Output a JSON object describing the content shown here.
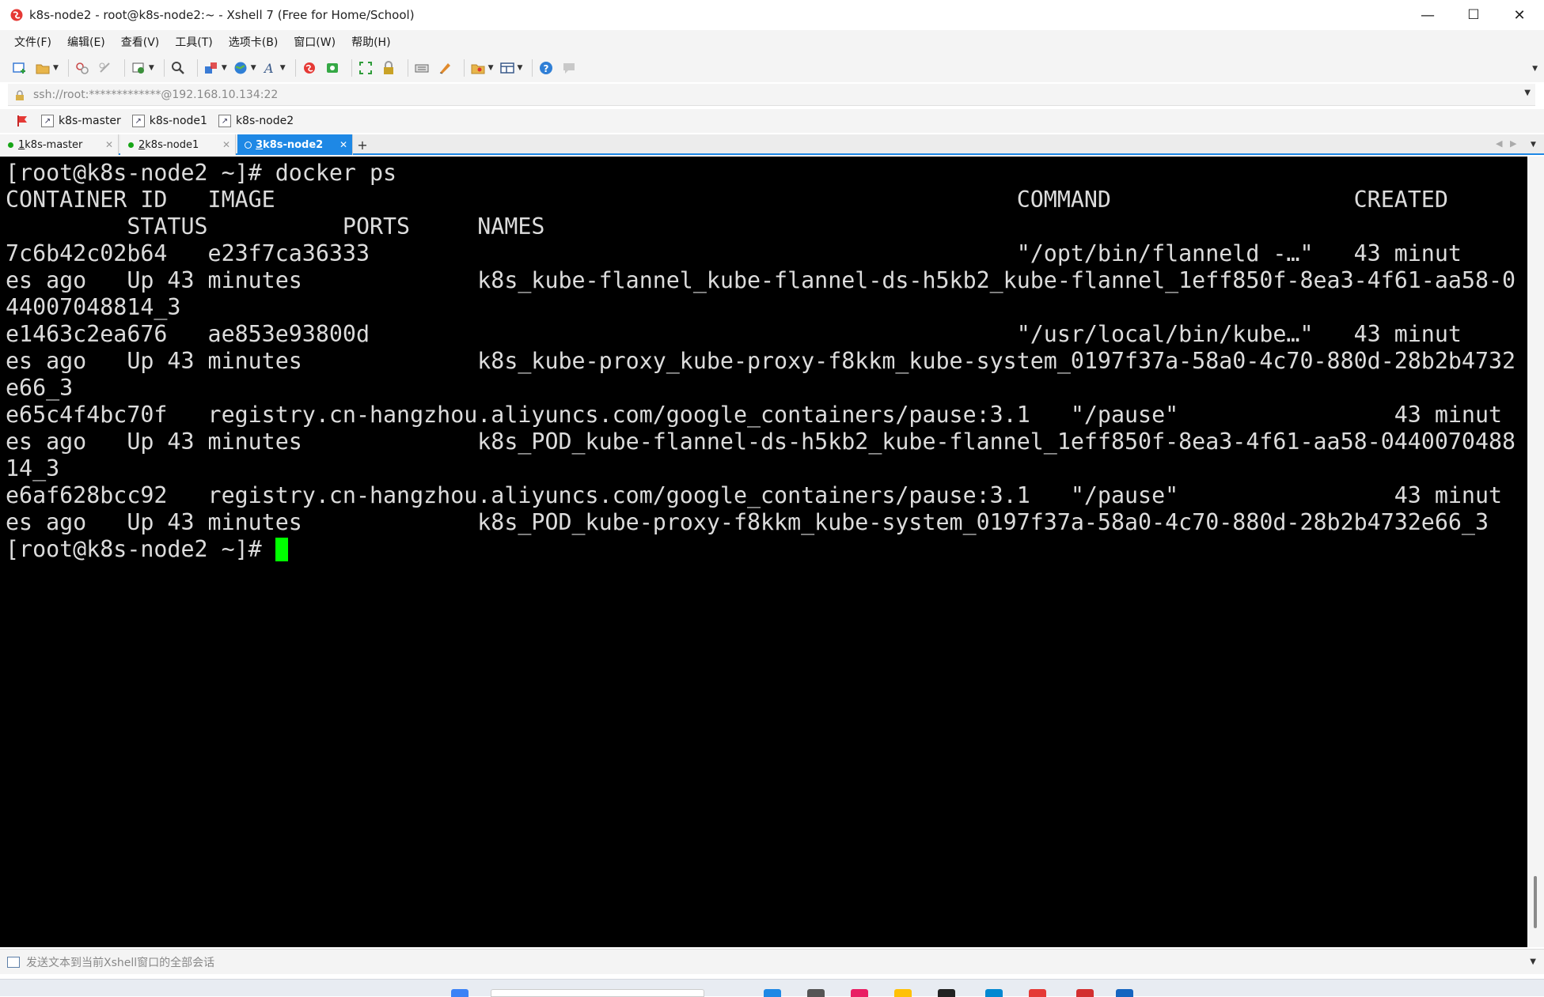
{
  "window": {
    "title": "k8s-node2 - root@k8s-node2:~ - Xshell 7 (Free for Home/School)",
    "minimize": "—",
    "maximize": "☐",
    "close": "✕"
  },
  "menu": [
    "文件(F)",
    "编辑(E)",
    "查看(V)",
    "工具(T)",
    "选项卡(B)",
    "窗口(W)",
    "帮助(H)"
  ],
  "address": {
    "value": "ssh://root:*************@192.168.10.134:22"
  },
  "bookmarks": [
    "k8s-master",
    "k8s-node1",
    "k8s-node2"
  ],
  "tabs": [
    {
      "number": "1",
      "label": " k8s-master",
      "active": false
    },
    {
      "number": "2",
      "label": " k8s-node1",
      "active": false
    },
    {
      "number": "3",
      "label": " k8s-node2",
      "active": true
    }
  ],
  "terminal": {
    "lines": [
      "[root@k8s-node2 ~]# docker ps",
      "CONTAINER ID   IMAGE                                                       COMMAND                  CREATED",
      "         STATUS          PORTS     NAMES",
      "7c6b42c02b64   e23f7ca36333                                                \"/opt/bin/flanneld -…\"   43 minut",
      "es ago   Up 43 minutes             k8s_kube-flannel_kube-flannel-ds-h5kb2_kube-flannel_1eff850f-8ea3-4f61-aa58-0",
      "44007048814_3",
      "e1463c2ea676   ae853e93800d                                                \"/usr/local/bin/kube…\"   43 minut",
      "es ago   Up 43 minutes             k8s_kube-proxy_kube-proxy-f8kkm_kube-system_0197f37a-58a0-4c70-880d-28b2b4732",
      "e66_3",
      "e65c4f4bc70f   registry.cn-hangzhou.aliyuncs.com/google_containers/pause:3.1   \"/pause\"                43 minut",
      "es ago   Up 43 minutes             k8s_POD_kube-flannel-ds-h5kb2_kube-flannel_1eff850f-8ea3-4f61-aa58-0440070488",
      "14_3",
      "e6af628bcc92   registry.cn-hangzhou.aliyuncs.com/google_containers/pause:3.1   \"/pause\"                43 minut",
      "es ago   Up 43 minutes             k8s_POD_kube-proxy-f8kkm_kube-system_0197f37a-58a0-4c70-880d-28b2b4732e66_3"
    ],
    "prompt": "[root@k8s-node2 ~]# "
  },
  "sendbar": {
    "placeholder": "发送文本到当前Xshell窗口的全部会话"
  },
  "colors": {
    "accent": "#1e88e5",
    "terminal_bg": "#000000",
    "terminal_fg": "#dcdcdc",
    "cursor": "#00ff00",
    "session_dot": "#16a516"
  }
}
